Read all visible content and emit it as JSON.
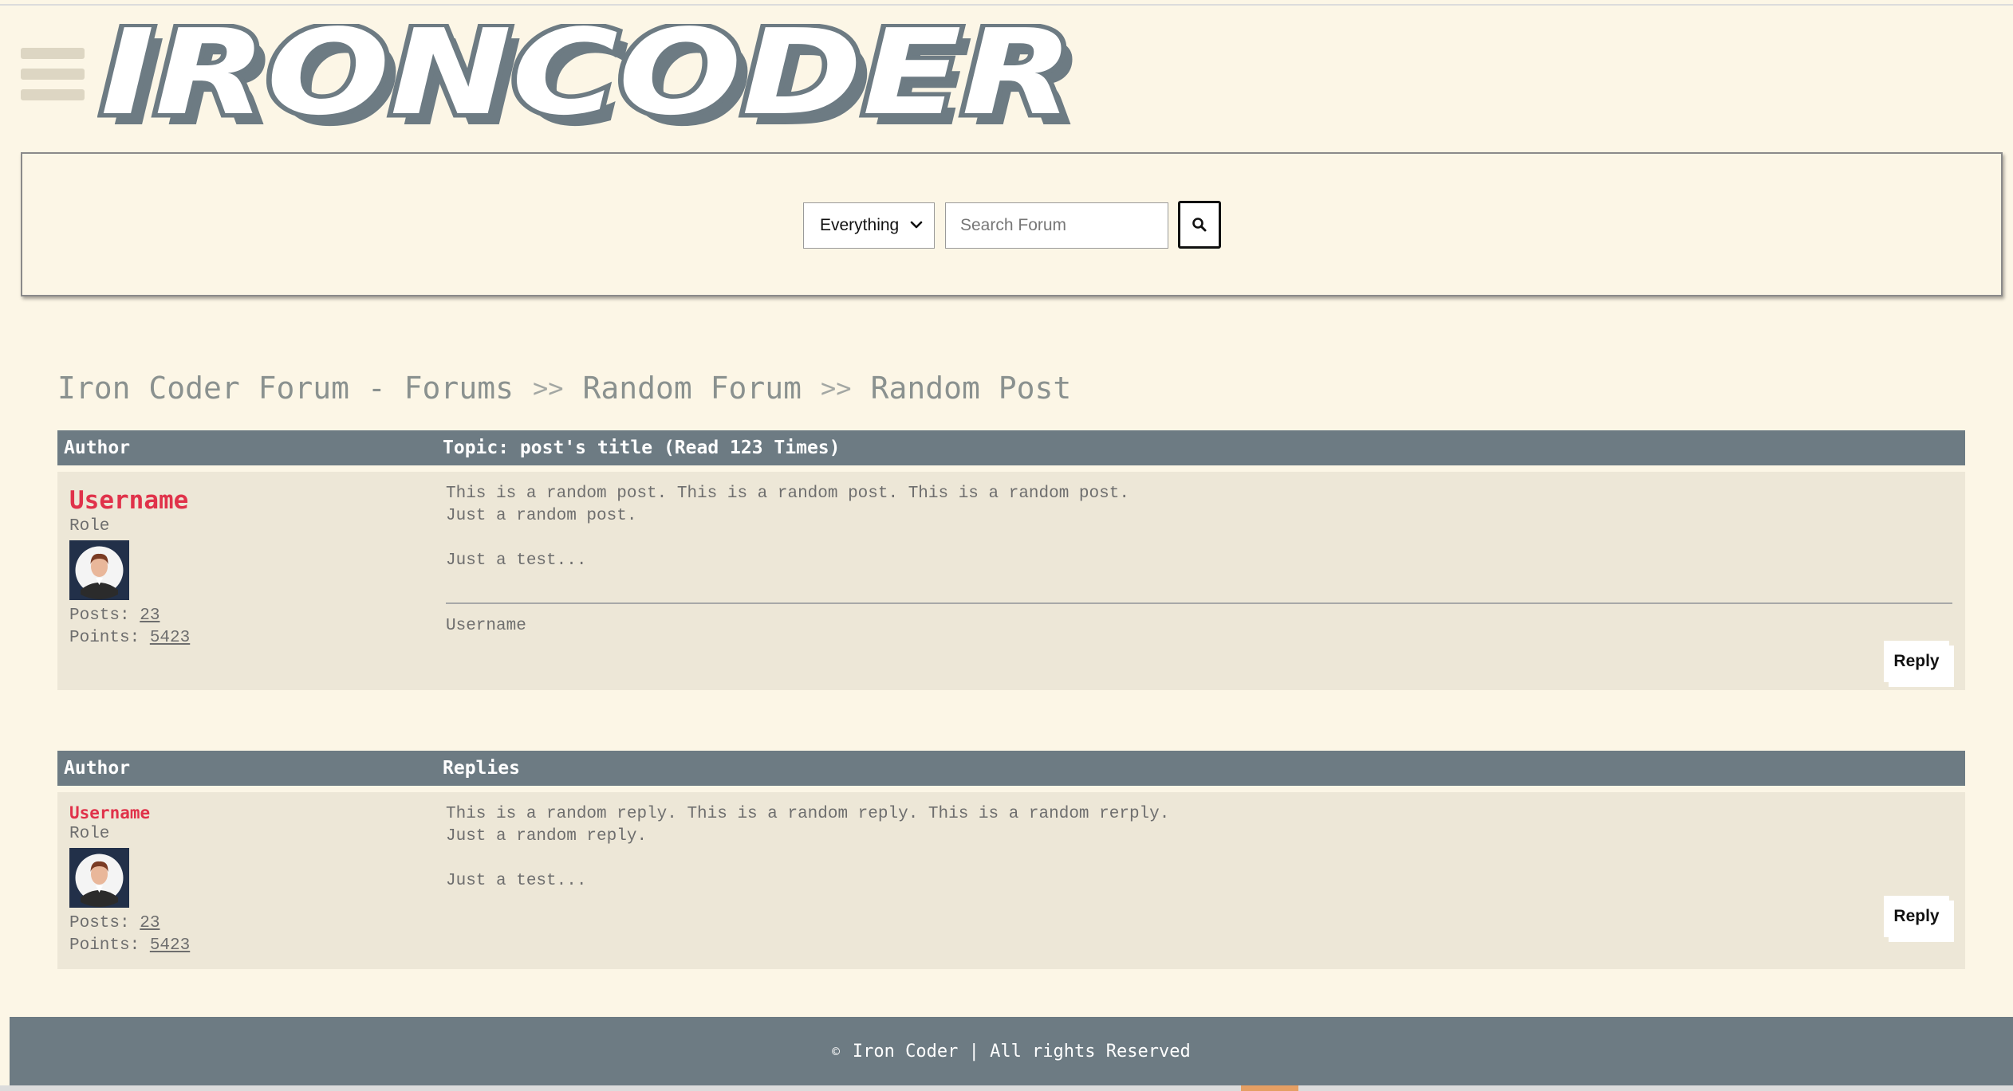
{
  "logo": {
    "text": "IRONCODER"
  },
  "search": {
    "scope_selected": "Everything",
    "placeholder": "Search Forum",
    "button_icon": "search-icon"
  },
  "breadcrumb": {
    "items": [
      "Iron Coder Forum - Forums",
      "Random Forum",
      "Random Post"
    ],
    "separator": ">>"
  },
  "post": {
    "header_author": "Author",
    "header_topic": "Topic: post's title (Read 123 Times)",
    "username": "Username",
    "role": "Role",
    "posts_label": "Posts:",
    "posts_value": "23",
    "points_label": "Points:",
    "points_value": "5423",
    "body": "This is a random post. This is a random post. This is a random post.\nJust a random post.\n\nJust a test...",
    "signature": "Username",
    "reply_label": "Reply"
  },
  "replies": {
    "header_author": "Author",
    "header_replies": "Replies",
    "items": [
      {
        "username": "Username",
        "role": "Role",
        "posts_label": "Posts:",
        "posts_value": "23",
        "points_label": "Points:",
        "points_value": "5423",
        "body": "This is a random reply. This is a random reply. This is a random rerply.\nJust a random reply.\n\nJust a test...",
        "reply_label": "Reply"
      }
    ]
  },
  "footer": {
    "copyright_symbol": "©",
    "text": "Iron Coder | All rights Reserved"
  },
  "colors": {
    "page_bg": "#fcf6e6",
    "header_bar": "#6d7b83",
    "row_bg": "#ede7d7",
    "username_red": "#e0324a",
    "logo_gray": "#6d7b83"
  }
}
